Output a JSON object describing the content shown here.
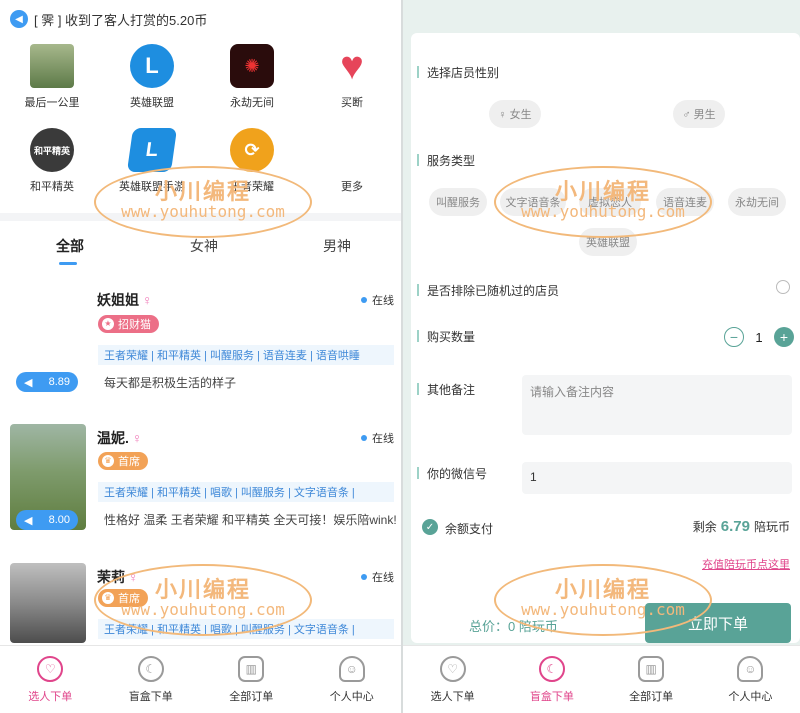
{
  "left": {
    "notice": {
      "icon": "speaker-icon",
      "text": "[ 霁 ] 收到了客人打赏的5.20币"
    },
    "games": [
      {
        "label": "最后一公里",
        "icon": "photo-thumbnail",
        "color": "#6b8a52"
      },
      {
        "label": "英雄联盟",
        "icon": "lol-logo-icon",
        "color": "#1e8ee0"
      },
      {
        "label": "永劫无间",
        "icon": "naraka-logo-icon",
        "color": "#b3261e"
      },
      {
        "label": "买断",
        "icon": "heart-pulse-icon",
        "color": "#e6455a"
      },
      {
        "label": "和平精英",
        "icon": "pubg-logo-icon",
        "color": "#3a3a3a"
      },
      {
        "label": "英雄联盟手游",
        "icon": "wild-rift-icon",
        "color": "#1e8ee0"
      },
      {
        "label": "王者荣耀",
        "icon": "honor-of-kings-icon",
        "color": "#f0a21c"
      },
      {
        "label": "更多",
        "icon": "more-icon",
        "color": "#ffffff"
      }
    ],
    "tabs": [
      "全部",
      "女神",
      "男神"
    ],
    "cards": [
      {
        "name": "妖姐姐",
        "gender": "♀",
        "status": "在线",
        "badge": "招财猫",
        "badge_color": "#ec6f87",
        "skills": "王者荣耀 | 和平精英 | 叫醒服务 | 语音连麦 | 语音哄睡",
        "desc": "每天都是积极生活的样子",
        "voice": "8.89"
      },
      {
        "name": "温妮.",
        "gender": "♀",
        "status": "在线",
        "badge": "首席",
        "badge_color": "#f2a257",
        "skills": "王者荣耀 | 和平精英 | 唱歌 | 叫醒服务 | 文字语音条 |",
        "desc": "性格好 温柔 王者荣耀 和平精英 全天可接！娱乐陪wink!",
        "voice": "8.00"
      },
      {
        "name": "茉莉",
        "gender": "♀",
        "status": "在线",
        "badge": "首席",
        "badge_color": "#f2a257",
        "skills": "王者荣耀 | 和平精英 | 唱歌 | 叫醒服务 | 文字语音条 |",
        "desc": "",
        "voice": ""
      }
    ],
    "nav": [
      {
        "label": "选人下单",
        "icon": "heart-outline-icon",
        "active": true
      },
      {
        "label": "盲盒下单",
        "icon": "moon-outline-icon",
        "active": false
      },
      {
        "label": "全部订单",
        "icon": "chart-list-icon",
        "active": false
      },
      {
        "label": "个人中心",
        "icon": "user-outline-icon",
        "active": false
      }
    ]
  },
  "right": {
    "gender_label": "选择店员性别",
    "gender_female": "♀ 女生",
    "gender_male": "♂ 男生",
    "service_label": "服务类型",
    "services": [
      "叫醒服务",
      "文字语音条",
      "虚拟恋人",
      "语音连麦",
      "永劫无间",
      "英雄联盟"
    ],
    "exclude_label": "是否排除已随机过的店员",
    "qty_label": "购买数量",
    "qty_minus": "−",
    "qty_value": "1",
    "qty_plus": "+",
    "remark_label": "其他备注",
    "remark_placeholder": "请输入备注内容",
    "wechat_label": "你的微信号",
    "wechat_value": "1",
    "balance_label": "余额支付",
    "balance_prefix": "剩余",
    "balance_amount": "6.79",
    "balance_unit": "陪玩币",
    "recharge_link": "充值陪玩币点这里",
    "total_text": "总价：0 陪玩币",
    "submit_label": "立即下单",
    "nav": [
      {
        "label": "选人下单",
        "icon": "heart-outline-icon",
        "active": false
      },
      {
        "label": "盲盒下单",
        "icon": "moon-outline-icon",
        "active": true
      },
      {
        "label": "全部订单",
        "icon": "chart-list-icon",
        "active": false
      },
      {
        "label": "个人中心",
        "icon": "user-outline-icon",
        "active": false
      }
    ]
  },
  "watermark": {
    "line1": "小川编程",
    "line2": "www.youhutong.com"
  }
}
